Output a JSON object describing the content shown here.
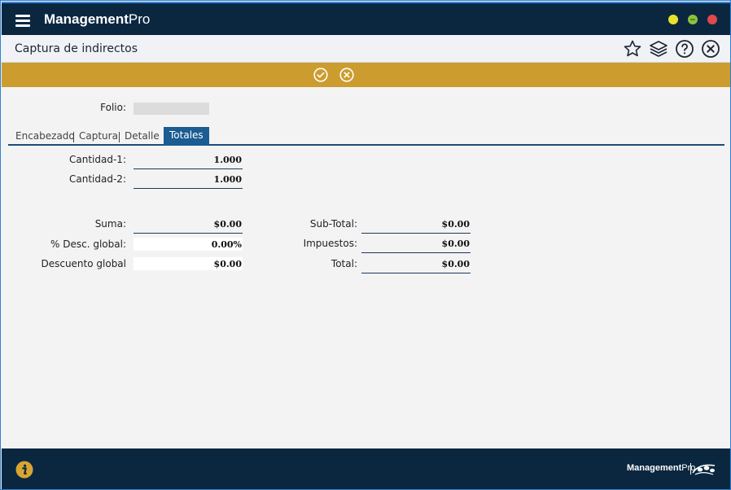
{
  "app": {
    "brand_bold": "Management",
    "brand_light": "Pro",
    "colors": {
      "header": "#0b2740",
      "action_bar": "#cc9c2f",
      "active_tab": "#1b5c92"
    }
  },
  "window": {
    "title": "Captura de indirectos"
  },
  "form": {
    "folio_label": "Folio:",
    "folio_value": ""
  },
  "tabs": [
    {
      "label": "Encabezado",
      "active": false
    },
    {
      "label": "Captura",
      "active": false
    },
    {
      "label": "Detalle",
      "active": false
    },
    {
      "label": "Totales",
      "active": true
    }
  ],
  "totals": {
    "cantidad1_label": "Cantidad-1:",
    "cantidad1_value": "1.000",
    "cantidad2_label": "Cantidad-2:",
    "cantidad2_value": "1.000",
    "suma_label": "Suma:",
    "suma_value": "$0.00",
    "desc_pct_label": "% Desc. global:",
    "desc_pct_value": "0.00%",
    "desc_global_label": "Descuento global",
    "desc_global_value": "$0.00",
    "subtotal_label": "Sub-Total:",
    "subtotal_value": "$0.00",
    "impuestos_label": "Impuestos:",
    "impuestos_value": "$0.00",
    "total_label": "Total:",
    "total_value": "$0.00"
  },
  "footer": {
    "brand_bold": "Management",
    "brand_light": "Pro"
  }
}
